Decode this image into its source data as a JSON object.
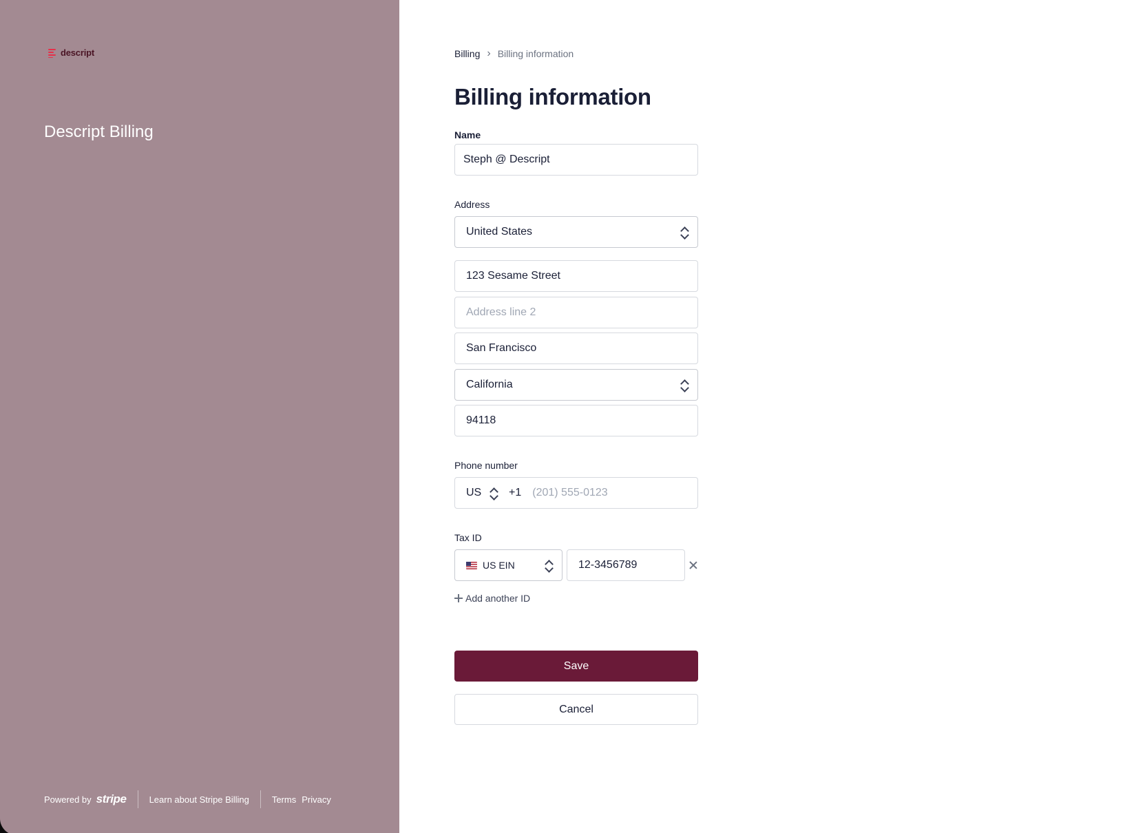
{
  "brand": {
    "logo_text": "descript",
    "title": "Descript Billing",
    "accent_color": "#6a1a38",
    "panel_color": "#a38a92"
  },
  "footer": {
    "powered_by": "Powered by",
    "stripe": "stripe",
    "learn_link": "Learn about Stripe Billing",
    "terms_link": "Terms",
    "privacy_link": "Privacy"
  },
  "breadcrumb": {
    "root": "Billing",
    "current": "Billing information"
  },
  "page_title": "Billing information",
  "form": {
    "name_label": "Name",
    "name_value": "Steph @ Descript",
    "address_label": "Address",
    "country": "United States",
    "address_line1": "123 Sesame Street",
    "address_line2_placeholder": "Address line 2",
    "city": "San Francisco",
    "state": "California",
    "zip": "94118",
    "phone_label": "Phone number",
    "phone_country": "US",
    "phone_code": "+1",
    "phone_placeholder": "(201) 555-0123",
    "tax_label": "Tax ID",
    "tax_type": "US EIN",
    "tax_value": "12-3456789",
    "add_another": "Add another ID",
    "save": "Save",
    "cancel": "Cancel"
  }
}
